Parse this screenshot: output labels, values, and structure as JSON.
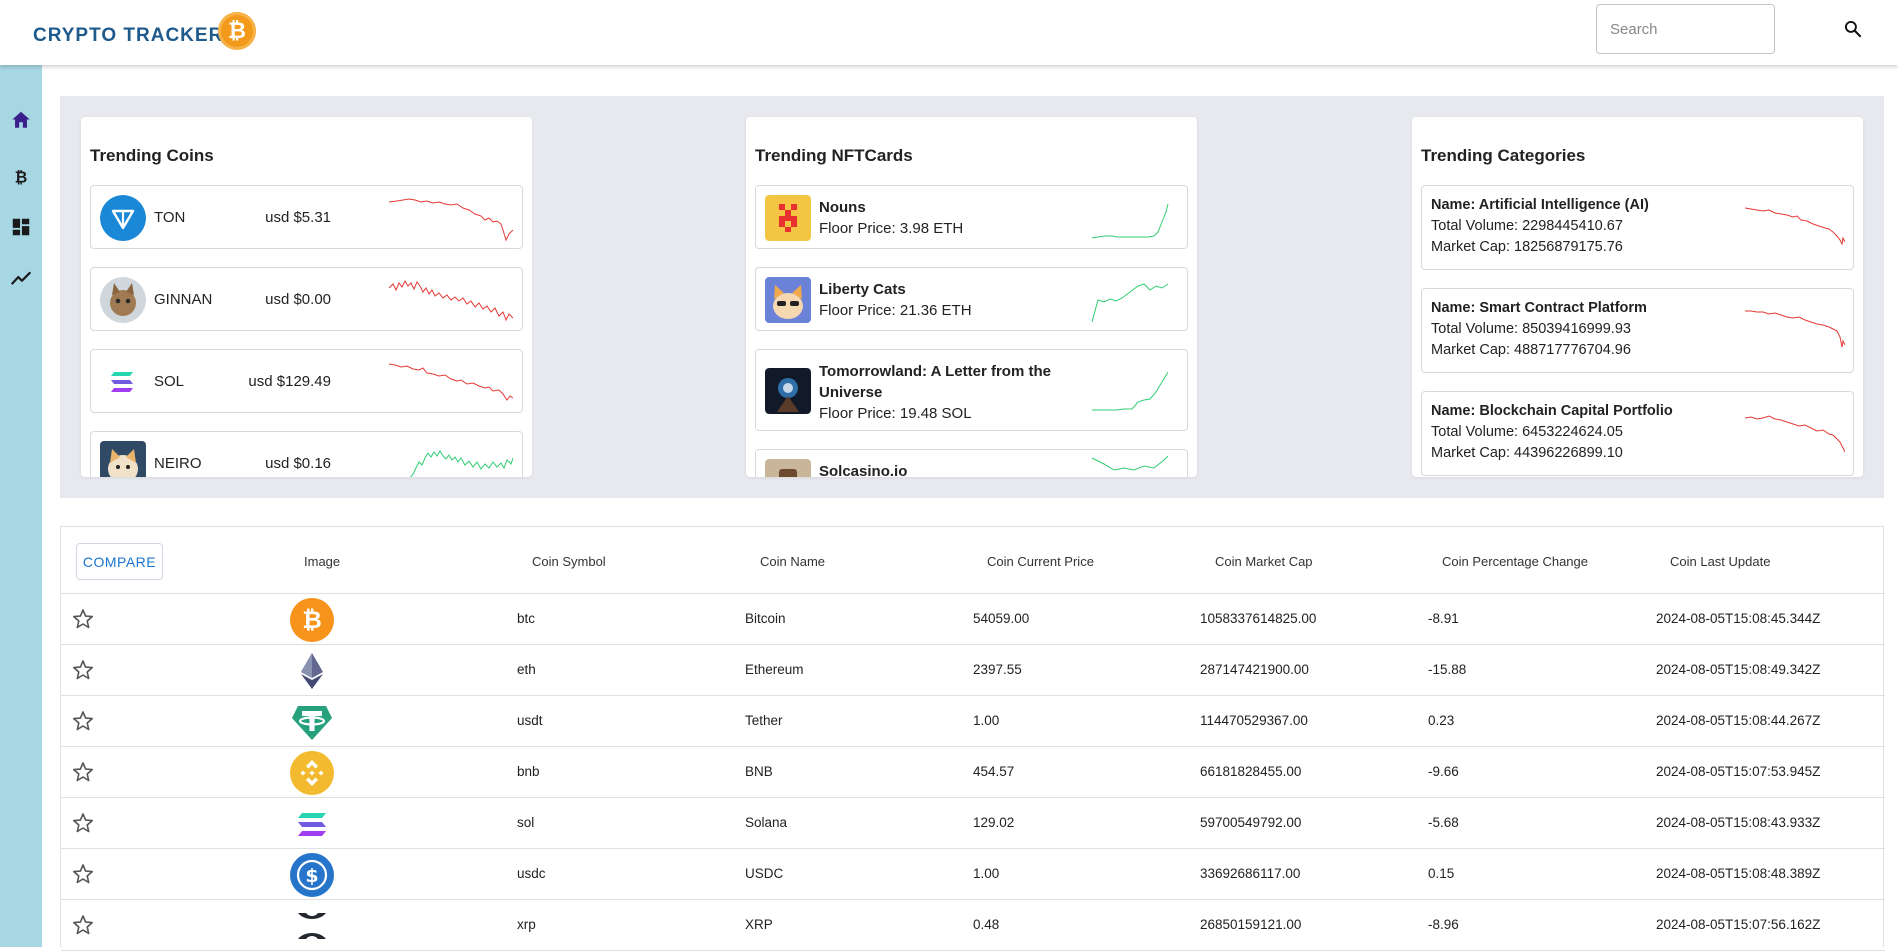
{
  "header": {
    "brand": "CRYPTO TRACKER",
    "logo_glyph": "₿",
    "search_placeholder": "Search"
  },
  "sidebar": {
    "items": [
      {
        "icon": "home-icon",
        "label": "Home",
        "active": true
      },
      {
        "icon": "bitcoin-icon",
        "label": "Coins"
      },
      {
        "icon": "dashboard-icon",
        "label": "Dashboard"
      },
      {
        "icon": "trending-icon",
        "label": "Trends"
      }
    ]
  },
  "trending_coins": {
    "title": "Trending Coins",
    "items": [
      {
        "name": "TON",
        "price": "usd $5.31",
        "trend": "down",
        "icon": "ton-logo"
      },
      {
        "name": "GINNAN",
        "price": "usd $0.00",
        "trend": "down",
        "icon": "ginnan-cat-logo"
      },
      {
        "name": "SOL",
        "price": "usd $129.49",
        "trend": "down",
        "icon": "solana-logo"
      },
      {
        "name": "NEIRO",
        "price": "usd $0.16",
        "trend": "up",
        "icon": "neiro-dog-logo"
      }
    ]
  },
  "trending_nfts": {
    "title": "Trending NFTCards",
    "items": [
      {
        "name": "Nouns",
        "floor": "Floor Price: 3.98 ETH",
        "trend": "up",
        "icon": "nouns-logo"
      },
      {
        "name": "Liberty Cats",
        "floor": "Floor Price: 21.36 ETH",
        "trend": "up",
        "icon": "liberty-cats-logo"
      },
      {
        "name": "Tomorrowland: A Letter from the Universe",
        "floor": "Floor Price: 19.48 SOL",
        "trend": "up",
        "icon": "tomorrowland-logo"
      },
      {
        "name": "Solcasino.io",
        "floor": "",
        "trend": "up",
        "icon": "solcasino-logo"
      }
    ]
  },
  "trending_categories": {
    "title": "Trending Categories",
    "items": [
      {
        "name": "Name: Artificial Intelligence (AI)",
        "volume": "Total Volume: 2298445410.67",
        "cap": "Market Cap: 18256879175.76",
        "trend": "down"
      },
      {
        "name": "Name: Smart Contract Platform",
        "volume": "Total Volume: 85039416999.93",
        "cap": "Market Cap: 488717776704.96",
        "trend": "down"
      },
      {
        "name": "Name: Blockchain Capital Portfolio",
        "volume": "Total Volume: 6453224624.05",
        "cap": "Market Cap: 44396226899.10",
        "trend": "down"
      }
    ]
  },
  "table": {
    "compare_label": "COMPARE",
    "columns": [
      "Image",
      "Coin Symbol",
      "Coin Name",
      "Coin Current Price",
      "Coin Market Cap",
      "Coin Percentage Change",
      "Coin Last Update"
    ],
    "rows": [
      {
        "symbol": "btc",
        "name": "Bitcoin",
        "price": "54059.00",
        "cap": "1058337614825.00",
        "change": "-8.91",
        "updated": "2024-08-05T15:08:45.344Z",
        "icon": "bitcoin-logo"
      },
      {
        "symbol": "eth",
        "name": "Ethereum",
        "price": "2397.55",
        "cap": "287147421900.00",
        "change": "-15.88",
        "updated": "2024-08-05T15:08:49.342Z",
        "icon": "ethereum-logo"
      },
      {
        "symbol": "usdt",
        "name": "Tether",
        "price": "1.00",
        "cap": "114470529367.00",
        "change": "0.23",
        "updated": "2024-08-05T15:08:44.267Z",
        "icon": "tether-logo"
      },
      {
        "symbol": "bnb",
        "name": "BNB",
        "price": "454.57",
        "cap": "66181828455.00",
        "change": "-9.66",
        "updated": "2024-08-05T15:07:53.945Z",
        "icon": "bnb-logo"
      },
      {
        "symbol": "sol",
        "name": "Solana",
        "price": "129.02",
        "cap": "59700549792.00",
        "change": "-5.68",
        "updated": "2024-08-05T15:08:43.933Z",
        "icon": "solana-logo"
      },
      {
        "symbol": "usdc",
        "name": "USDC",
        "price": "1.00",
        "cap": "33692686117.00",
        "change": "0.15",
        "updated": "2024-08-05T15:08:48.389Z",
        "icon": "usdc-logo"
      },
      {
        "symbol": "xrp",
        "name": "XRP",
        "price": "0.48",
        "cap": "26850159121.00",
        "change": "-8.96",
        "updated": "2024-08-05T15:07:56.162Z",
        "icon": "xrp-logo"
      }
    ]
  },
  "colors": {
    "accent": "#1f5a8c",
    "sidebar": "#a8d7e4",
    "active_icon": "#3a1e8c",
    "spark_up": "#2ecc71",
    "spark_down": "#e53935"
  }
}
